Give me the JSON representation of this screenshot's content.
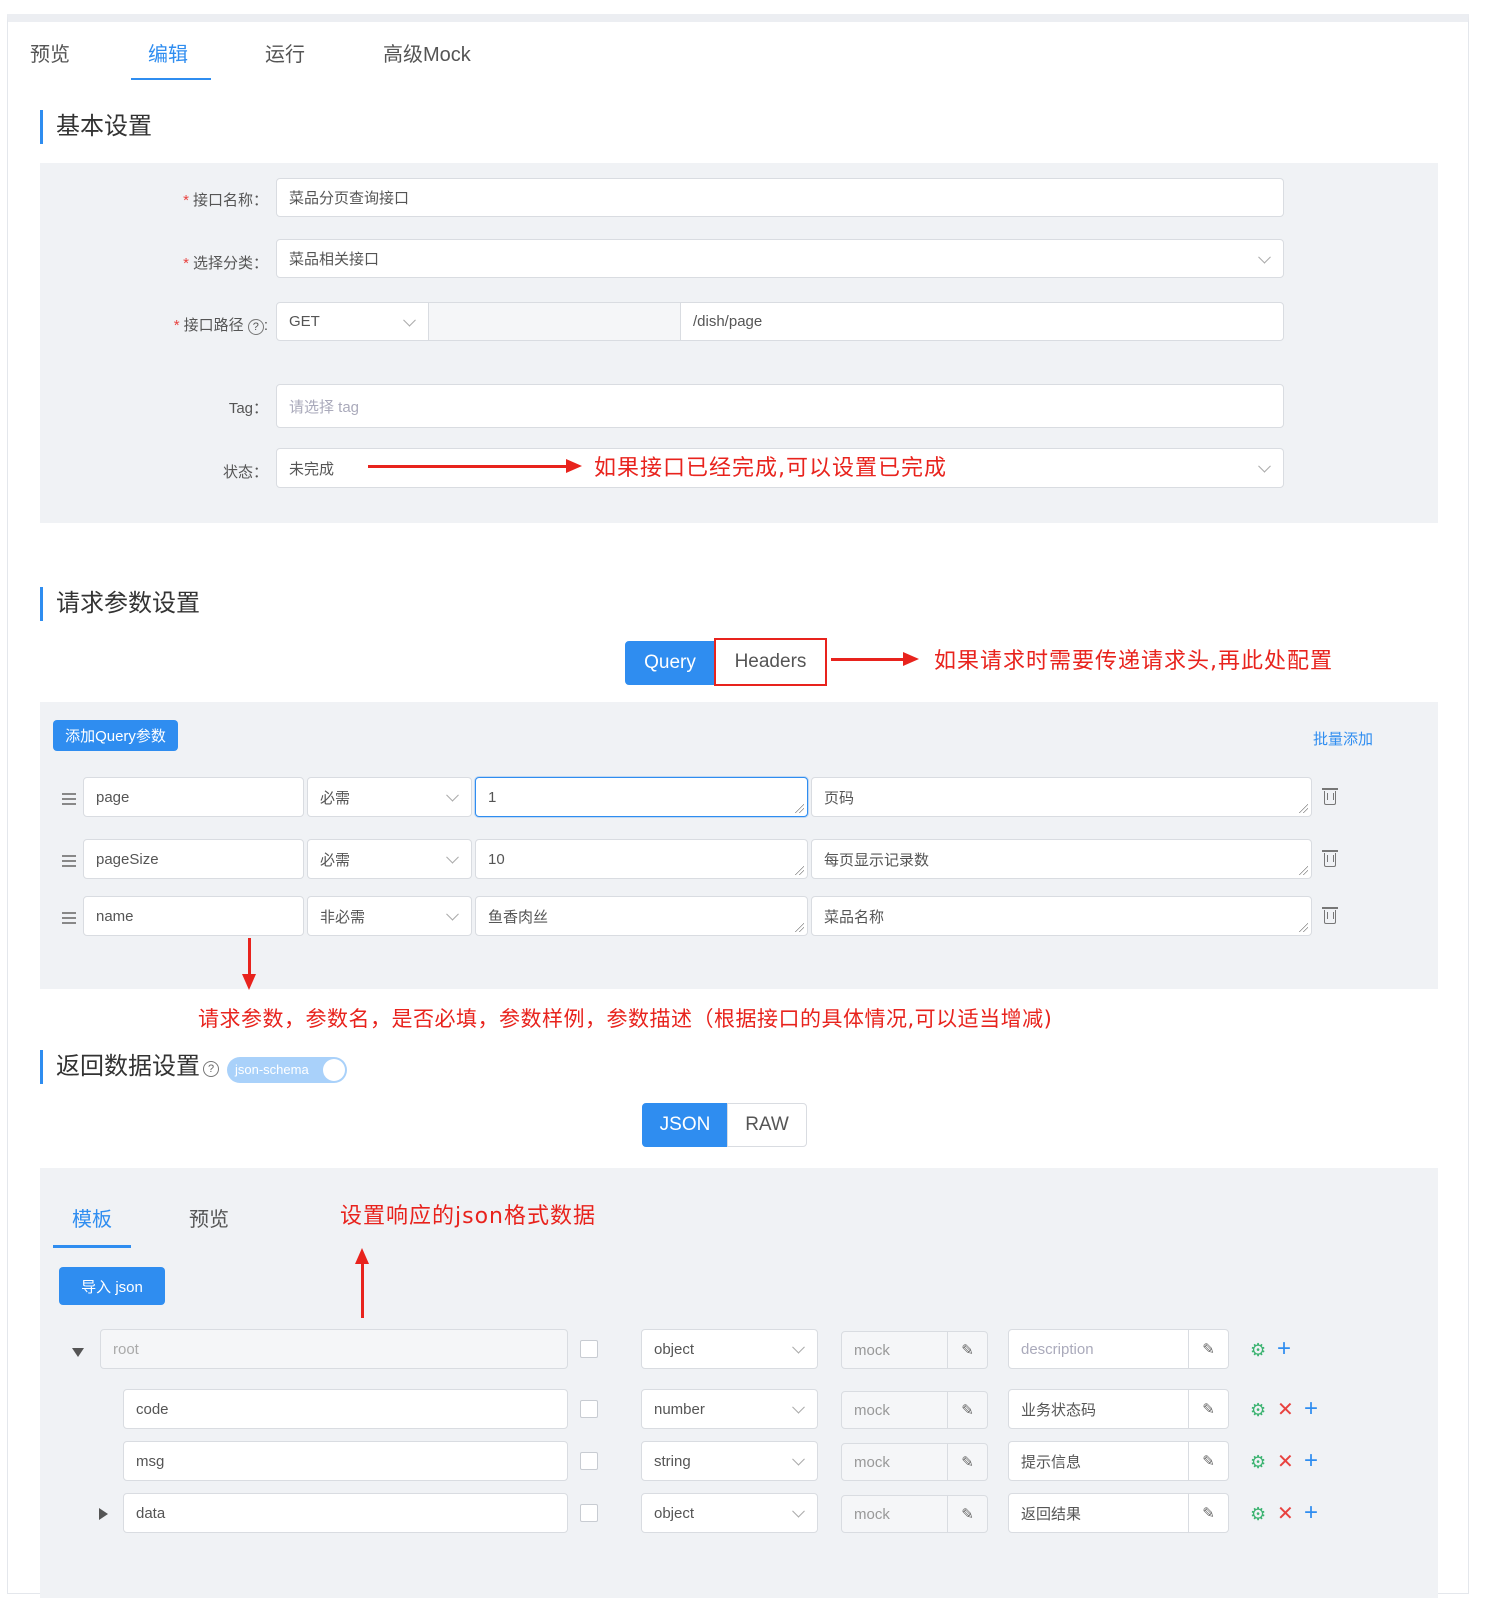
{
  "tabs": [
    "预览",
    "编辑",
    "运行",
    "高级Mock"
  ],
  "basic": {
    "title": "基本设置",
    "name_label": "接口名称：",
    "name_value": "菜品分页查询接口",
    "category_label": "选择分类：",
    "category_value": "菜品相关接口",
    "path_label": "接口路径",
    "path_label_suffix": ":",
    "method": "GET",
    "path_value": "/dish/page",
    "tag_label": "Tag：",
    "tag_placeholder": "请选择 tag",
    "status_label": "状态：",
    "status_value": "未完成",
    "status_note": "如果接口已经完成,可以设置已完成",
    "required_mark": "*"
  },
  "request": {
    "title": "请求参数设置",
    "tab_query": "Query",
    "tab_headers": "Headers",
    "headers_note": "如果请求时需要传递请求头,再此处配置",
    "add_button": "添加Query参数",
    "batch_add": "批量添加",
    "params": [
      {
        "name": "page",
        "required": "必需",
        "example": "1",
        "desc": "页码"
      },
      {
        "name": "pageSize",
        "required": "必需",
        "example": "10",
        "desc": "每页显示记录数"
      },
      {
        "name": "name",
        "required": "非必需",
        "example": "鱼香肉丝",
        "desc": "菜品名称"
      }
    ],
    "params_note": "请求参数，参数名，是否必填，参数样例，参数描述（根据接口的具体情况,可以适当增减)"
  },
  "response": {
    "title": "返回数据设置",
    "schema_toggle": "json-schema",
    "seg_json": "JSON",
    "seg_raw": "RAW",
    "tab_template": "模板",
    "tab_preview": "预览",
    "json_note": "设置响应的json格式数据",
    "import_button": "导入 json",
    "mock_placeholder": "mock",
    "root": {
      "name": "root",
      "type": "object",
      "desc_placeholder": "description"
    },
    "fields": [
      {
        "name": "code",
        "type": "number",
        "desc": "业务状态码"
      },
      {
        "name": "msg",
        "type": "string",
        "desc": "提示信息"
      },
      {
        "name": "data",
        "type": "object",
        "desc": "返回结果"
      }
    ]
  },
  "colors": {
    "accent": "#2f8df0",
    "annotation": "#e8231d",
    "panel": "#f0f2f5"
  }
}
